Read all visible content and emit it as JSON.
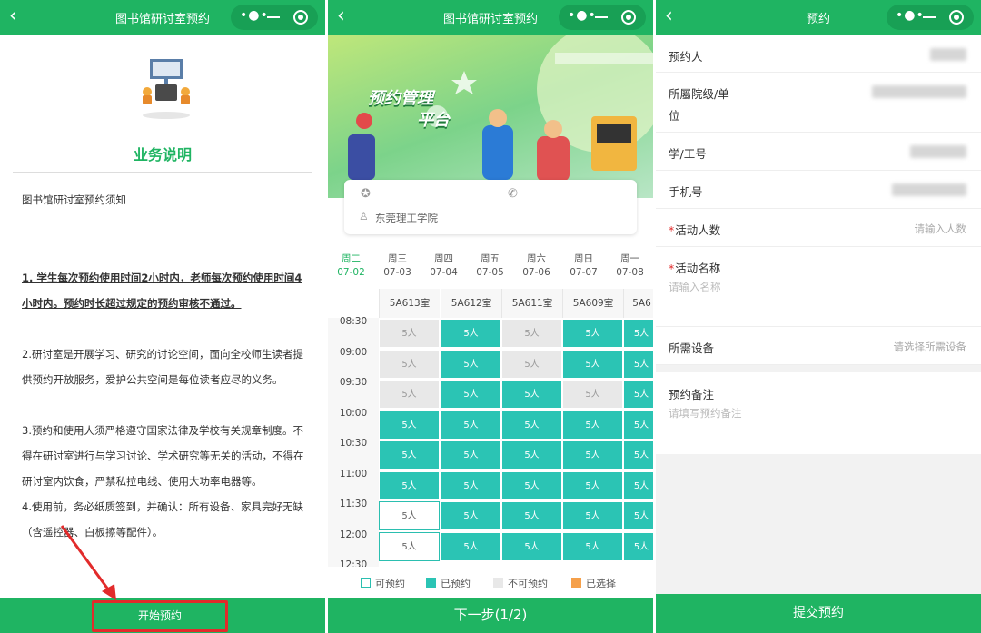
{
  "panel1": {
    "nav_title": "图书馆研讨室预约",
    "heading": "业务说明",
    "subtitle": "图书馆研讨室预约须知",
    "para1": "1. 学生每次预约使用时间2小时内，老师每次预约使用时间4小时内。预约时长超过规定的预约审核不通过。",
    "para2": "2.研讨室是开展学习、研究的讨论空间，面向全校师生读者提供预约开放服务，爱护公共空间是每位读者应尽的义务。",
    "para3": "3.预约和使用人须严格遵守国家法律及学校有关规章制度。不得在研讨室进行与学习讨论、学术研究等无关的活动，不得在研讨室内饮食，严禁私拉电线、使用大功率电器等。",
    "para4": "4.使用前，务必纸质签到，并确认：所有设备、家具完好无缺（含遥控器、白板擦等配件）。",
    "start_button": "开始预约"
  },
  "panel2": {
    "nav_title": "图书馆研讨室预约",
    "banner_line1": "预约管理",
    "banner_line2": "平台",
    "location": "东莞理工学院",
    "days": [
      {
        "week": "周二",
        "date": "07-02",
        "active": true
      },
      {
        "week": "周三",
        "date": "07-03",
        "active": false
      },
      {
        "week": "周四",
        "date": "07-04",
        "active": false
      },
      {
        "week": "周五",
        "date": "07-05",
        "active": false
      },
      {
        "week": "周六",
        "date": "07-06",
        "active": false
      },
      {
        "week": "周日",
        "date": "07-07",
        "active": false
      },
      {
        "week": "周一",
        "date": "07-08",
        "active": false
      }
    ],
    "rooms": [
      "5A613室",
      "5A612室",
      "5A611室",
      "5A609室",
      "5A6"
    ],
    "times": [
      "08:30",
      "09:00",
      "09:30",
      "10:00",
      "10:30",
      "11:00",
      "11:30",
      "12:00",
      "12:30"
    ],
    "cell_label": "5人",
    "grid": [
      [
        "unavail",
        "booked",
        "unavail",
        "booked",
        "booked"
      ],
      [
        "unavail",
        "booked",
        "unavail",
        "booked",
        "booked"
      ],
      [
        "unavail",
        "booked",
        "booked",
        "unavail",
        "booked"
      ],
      [
        "booked",
        "booked",
        "booked",
        "booked",
        "booked"
      ],
      [
        "booked",
        "booked",
        "booked",
        "booked",
        "booked"
      ],
      [
        "booked",
        "booked",
        "booked",
        "booked",
        "booked"
      ],
      [
        "avail",
        "booked",
        "booked",
        "booked",
        "booked"
      ],
      [
        "avail",
        "booked",
        "booked",
        "booked",
        "booked"
      ]
    ],
    "legend": {
      "available": "可预约",
      "booked": "已预约",
      "unavailable": "不可预约",
      "selected": "已选择"
    },
    "colors": {
      "booked": "#2bc4b4",
      "unavailable": "#e8e8e8",
      "selected": "#f5a04a",
      "brand": "#1fb462"
    },
    "next_button": "下一步(1/2)"
  },
  "panel3": {
    "nav_title": "预约",
    "fields": {
      "reserver": "预约人",
      "college": "所屬院级/单位",
      "college_line1": "所屬院级/单",
      "college_line2": "位",
      "student_id": "学/工号",
      "phone": "手机号",
      "count_label": "活动人数",
      "count_placeholder": "请输入人数",
      "name_label": "活动名称",
      "name_placeholder": "请输入名称",
      "equipment_label": "所需设备",
      "equipment_placeholder": "请选择所需设备",
      "remark_label": "预约备注",
      "remark_placeholder": "请填写预约备注"
    },
    "submit_button": "提交预约"
  }
}
